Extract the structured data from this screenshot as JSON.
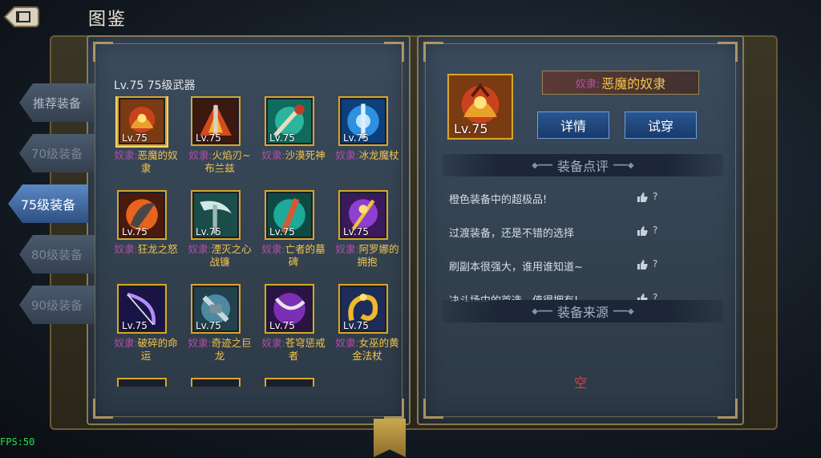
{
  "header": {
    "title": "图鉴"
  },
  "tabs": [
    {
      "label": "推荐装备",
      "state": "normal"
    },
    {
      "label": "70级装备",
      "state": "dim"
    },
    {
      "label": "75级装备",
      "state": "active"
    },
    {
      "label": "80级装备",
      "state": "dim"
    },
    {
      "label": "90级装备",
      "state": "dim"
    }
  ],
  "grid": {
    "title": "Lv.75 75级武器",
    "items": [
      {
        "level": "Lv.75",
        "prefix": "奴隶:",
        "name": "恶魔的奴隶",
        "art": "demon"
      },
      {
        "level": "Lv.75",
        "prefix": "奴隶:",
        "name": "火焰刃~布兰兹",
        "art": "fire"
      },
      {
        "level": "Lv.75",
        "prefix": "奴隶:",
        "name": "沙漠死神",
        "art": "desert"
      },
      {
        "level": "Lv.75",
        "prefix": "奴隶:",
        "name": "冰龙魔杖",
        "art": "ice"
      },
      {
        "level": "Lv.75",
        "prefix": "奴隶:",
        "name": "狂龙之怒",
        "art": "rage"
      },
      {
        "level": "Lv.75",
        "prefix": "奴隶:",
        "name": "湮灭之心战镰",
        "art": "scythe"
      },
      {
        "level": "Lv.75",
        "prefix": "奴隶:",
        "name": "亡者的墓碑",
        "art": "tomb"
      },
      {
        "level": "Lv.75",
        "prefix": "奴隶:",
        "name": "阿罗娜的拥抱",
        "art": "purple"
      },
      {
        "level": "Lv.75",
        "prefix": "奴隶:",
        "name": "破碎的命运",
        "art": "bow"
      },
      {
        "level": "Lv.75",
        "prefix": "奴隶:",
        "name": "奇迹之巨龙",
        "art": "dragon"
      },
      {
        "level": "Lv.75",
        "prefix": "奴隶:",
        "name": "苍穹惩戒者",
        "art": "violet"
      },
      {
        "level": "Lv.75",
        "prefix": "奴隶:",
        "name": "女巫的黄金法杖",
        "art": "gold"
      }
    ]
  },
  "detail": {
    "level": "Lv.75",
    "prefix": "奴隶:",
    "name": "恶魔的奴隶",
    "buttons": {
      "detail": "详情",
      "tryon": "试穿"
    },
    "review_title": "装备点评",
    "reviews": [
      {
        "text": "橙色装备中的超极品!",
        "q": "?"
      },
      {
        "text": "过渡装备，还是不错的选择",
        "q": "?"
      },
      {
        "text": "刷副本很强大，谁用谁知道~",
        "q": "?"
      },
      {
        "text": "决斗场中的首选，值得拥有!",
        "q": "?"
      }
    ],
    "source_title": "装备来源",
    "source_empty": "空"
  },
  "fps": "FPS:50",
  "colors": {
    "accent_gold": "#d9a628",
    "active_tab": "#5b89c4",
    "item_name": "#f2c44a",
    "empty_text": "#d0463f"
  }
}
